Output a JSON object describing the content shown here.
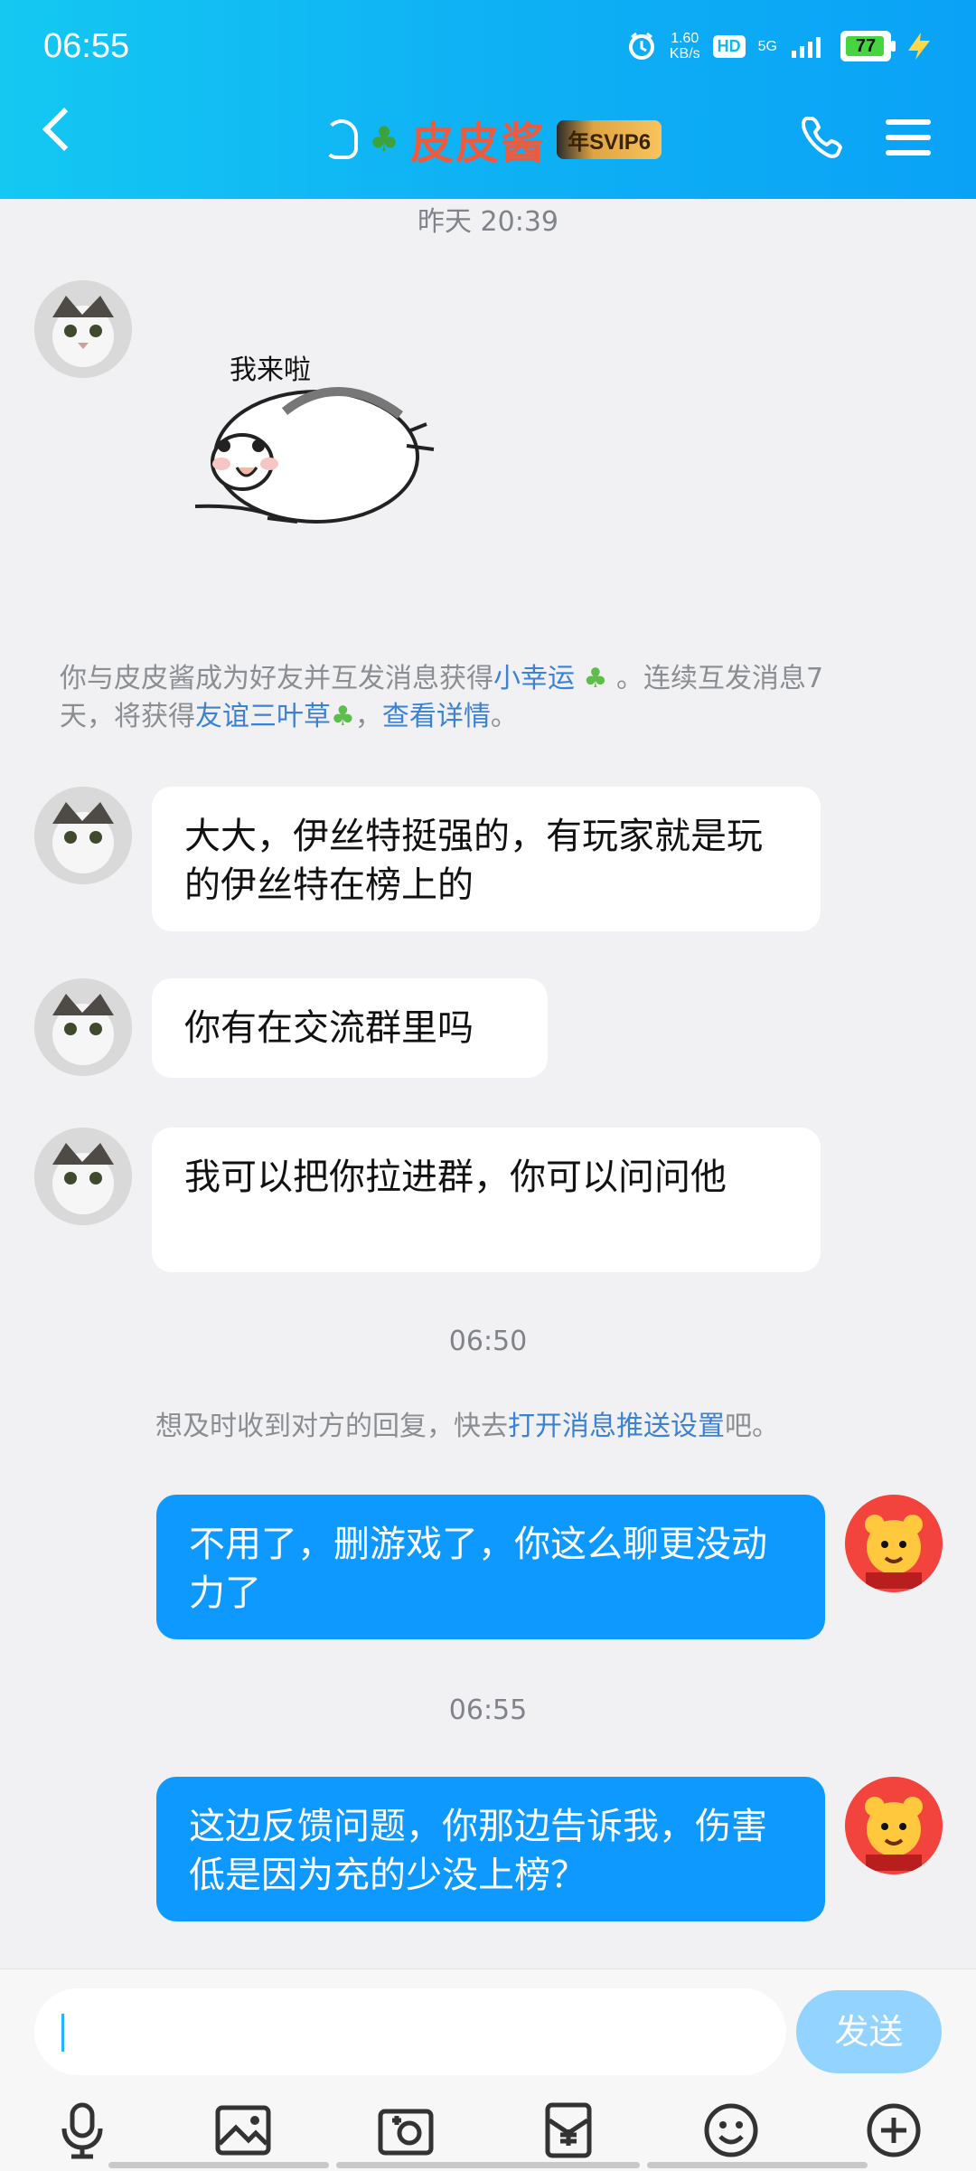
{
  "status": {
    "time": "06:55",
    "speed": "1.60",
    "speed_unit": "KB/s",
    "hd": "HD",
    "network": "5G",
    "battery": "77"
  },
  "header": {
    "title": "皮皮酱",
    "vip": "年SVIP6"
  },
  "timestamps": {
    "yesterday": "昨天 20:39",
    "t1": "06:50",
    "t2": "06:55"
  },
  "sticker": {
    "text": "我来啦"
  },
  "system": {
    "friend_note_1": "你与皮皮酱成为好友并互发消息获得",
    "friend_link_1": "小幸运",
    "friend_note_2": "。连续互发消息7",
    "friend_note_3": "天，将获得",
    "friend_link_2": "友谊三叶草",
    "friend_note_4": "，",
    "friend_link_3": "查看详情",
    "friend_note_5": "。",
    "push_note_1": "想及时收到对方的回复，快去",
    "push_link": "打开消息推送设置",
    "push_note_2": "吧。"
  },
  "messages": [
    {
      "side": "left",
      "text": "大大，伊丝特挺强的，有玩家就是玩的伊丝特在榜上的"
    },
    {
      "side": "left",
      "text": "你有在交流群里吗"
    },
    {
      "side": "left",
      "text": "我可以把你拉进群，你可以问问他"
    },
    {
      "side": "right",
      "text": "不用了，删游戏了，你这么聊更没动力了"
    },
    {
      "side": "right",
      "text": "这边反馈问题，你那边告诉我，伤害低是因为充的少没上榜？"
    }
  ],
  "composer": {
    "send": "发送"
  },
  "icons": [
    "microphone-icon",
    "image-icon",
    "camera-icon",
    "red-packet-icon",
    "emoji-icon",
    "plus-icon"
  ]
}
